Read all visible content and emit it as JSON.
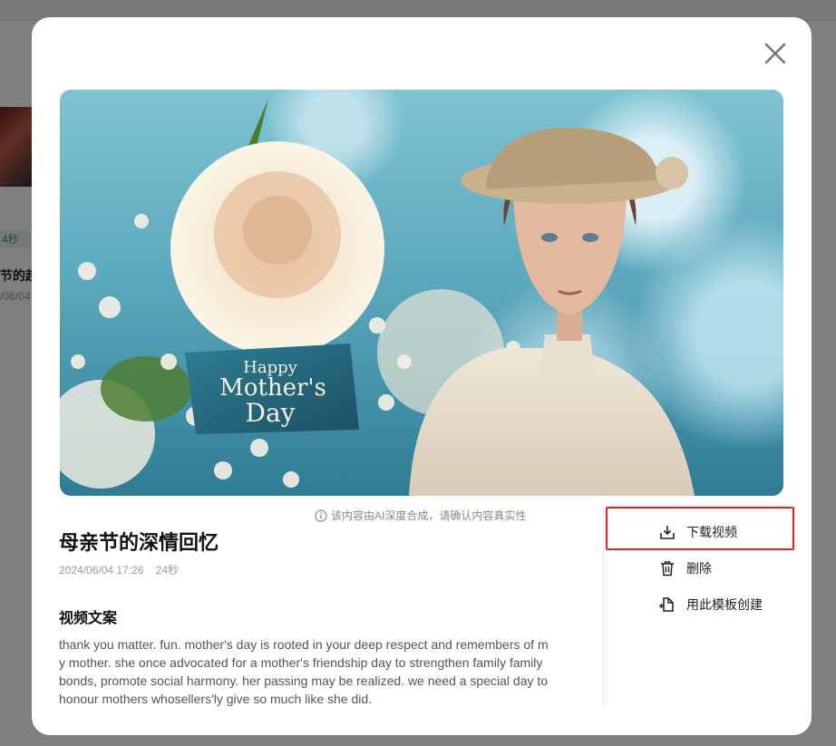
{
  "background": {
    "tag": "4秒",
    "card_title": "节的起",
    "card_date": "/06/04"
  },
  "modal": {
    "image_label": "Happy Mother's Day",
    "ai_notice": "该内容由AI深度合成，请确认内容真实性",
    "title": "母亲节的深情回忆",
    "date": "2024/06/04 17:26",
    "duration": "24秒",
    "script_heading": "视频文案",
    "script_text": "thank you matter. fun. mother's day is rooted in your deep respect and remembers of my mother. she once advocated for a mother's friendship day to strengthen family family bonds, promote social harmony. her passing may be realized. we need a special day to honour mothers whosellers'ly give so much like she did."
  },
  "actions": {
    "download": "下载视频",
    "delete": "删除",
    "use_template": "用此模板创建"
  },
  "colors": {
    "highlight": "#e8231e",
    "overlay": "rgba(0,0,0,0.5)"
  }
}
